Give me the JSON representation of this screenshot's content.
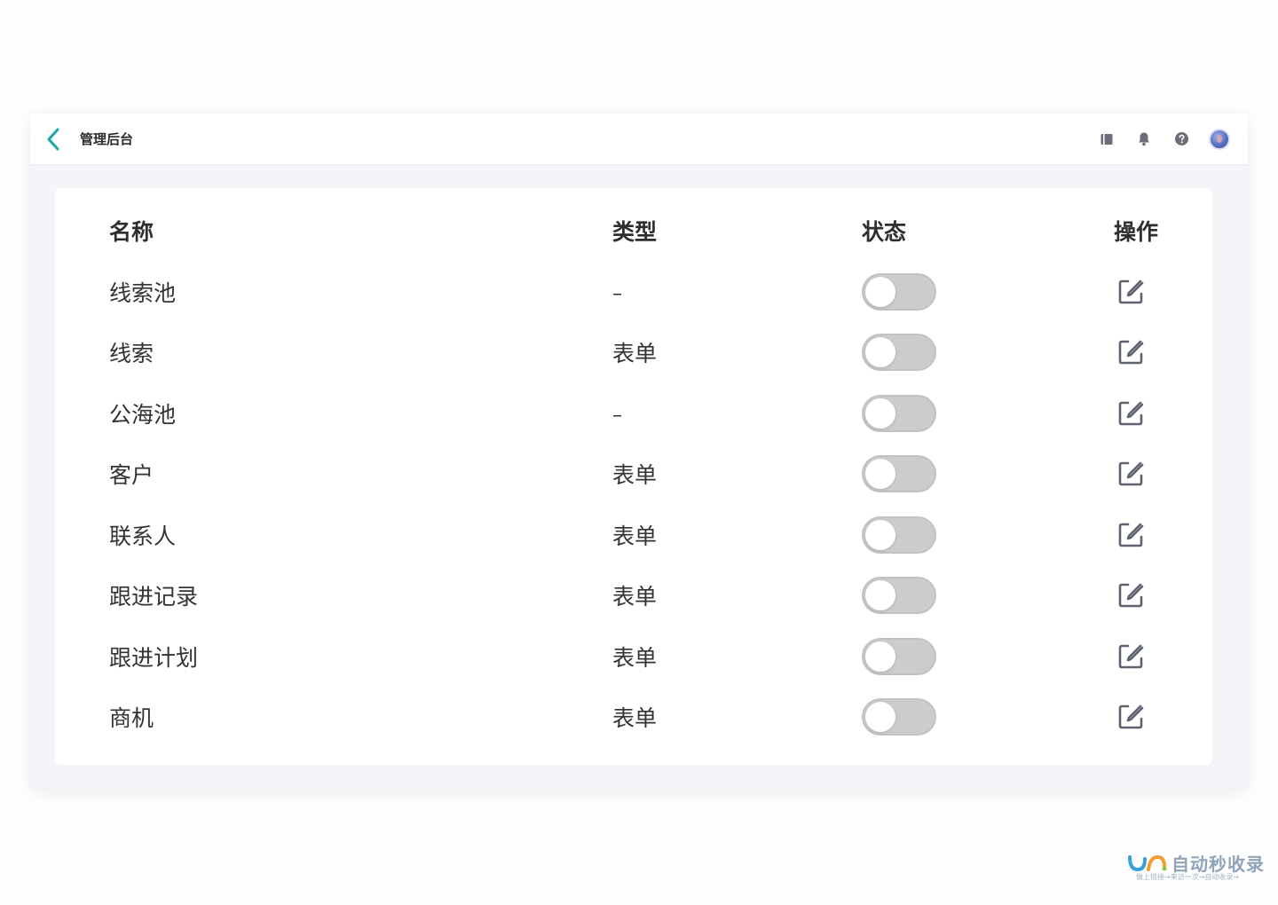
{
  "header": {
    "title": "管理后台",
    "icons": [
      "back-icon",
      "book-icon",
      "bell-icon",
      "help-icon",
      "avatar"
    ],
    "accent_color": "#19a8a8"
  },
  "table": {
    "columns": {
      "name": "名称",
      "type": "类型",
      "status": "状态",
      "action": "操作"
    },
    "rows": [
      {
        "name": "线索池",
        "type": "–",
        "enabled": false
      },
      {
        "name": "线索",
        "type": "表单",
        "enabled": false
      },
      {
        "name": "公海池",
        "type": "–",
        "enabled": false
      },
      {
        "name": "客户",
        "type": "表单",
        "enabled": false
      },
      {
        "name": "联系人",
        "type": "表单",
        "enabled": false
      },
      {
        "name": "跟进记录",
        "type": "表单",
        "enabled": false
      },
      {
        "name": "跟进计划",
        "type": "表单",
        "enabled": false
      },
      {
        "name": "商机",
        "type": "表单",
        "enabled": false
      }
    ],
    "toggle_off_color": "#cccccc"
  },
  "watermark": {
    "text": "自动秒收录",
    "subtext": "做上链接→来访一次→自动收录→"
  }
}
